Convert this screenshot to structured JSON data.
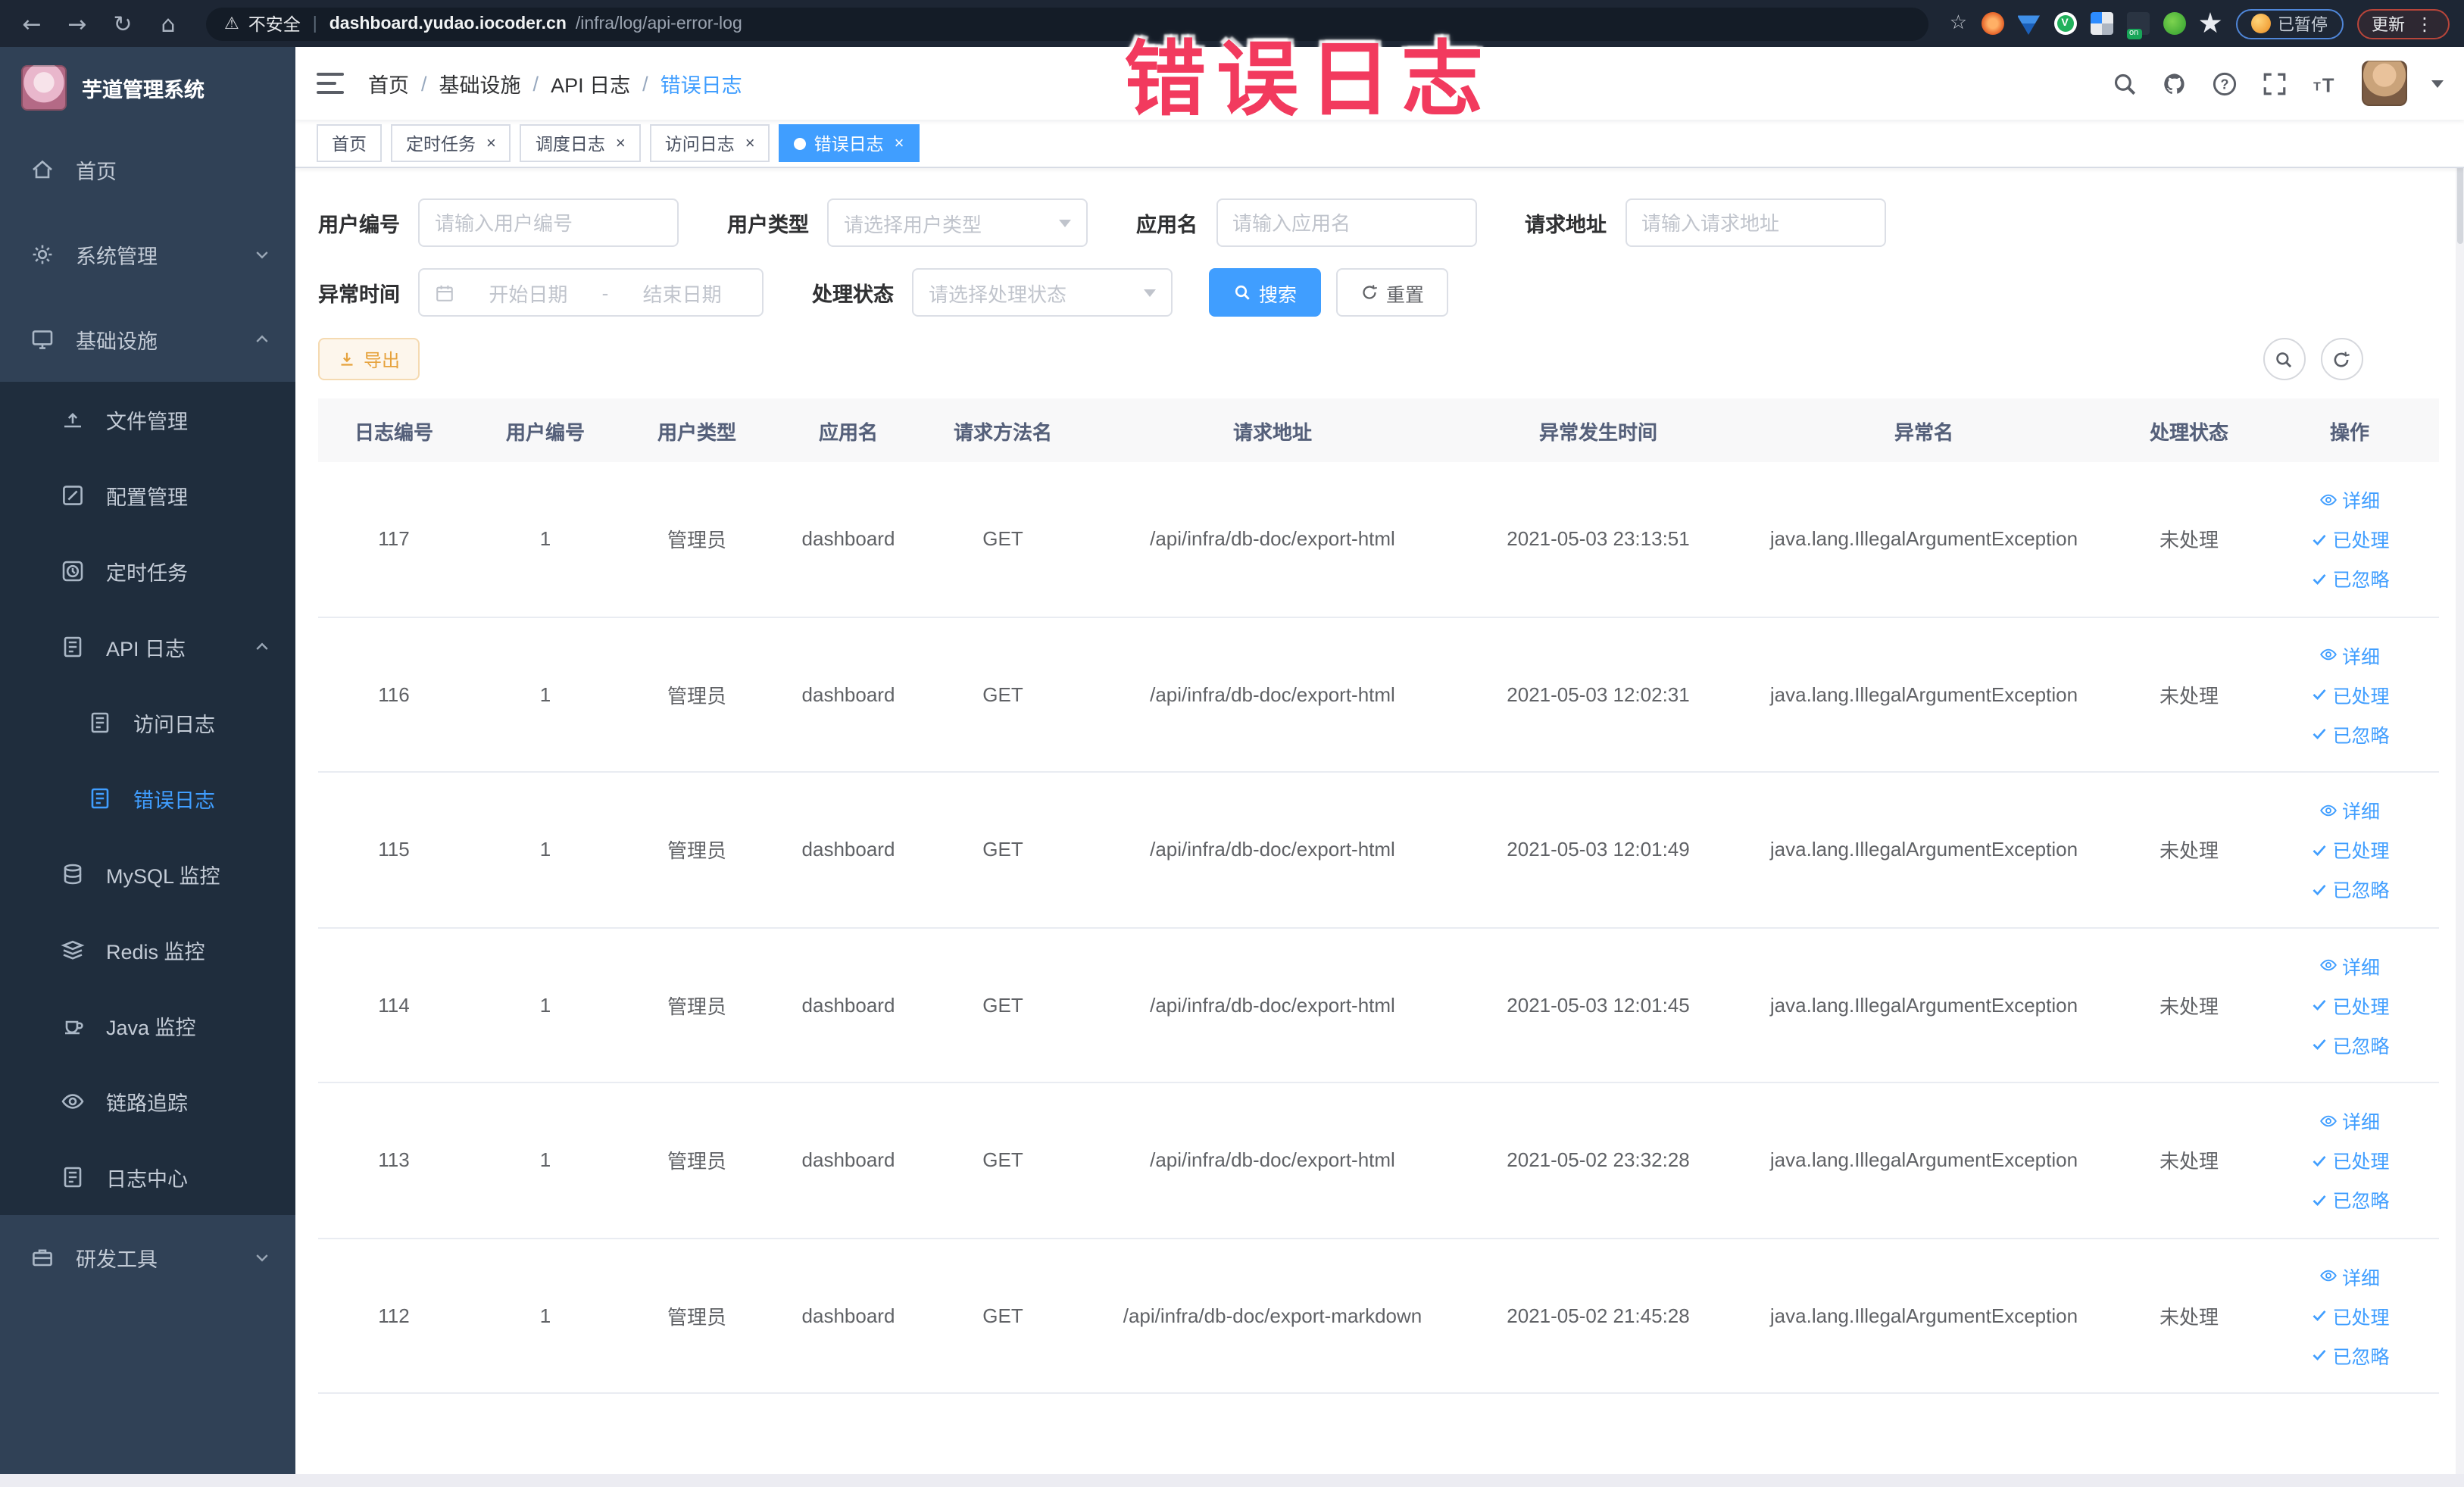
{
  "annotation": {
    "text": "错误日志",
    "color": "#f23a5e"
  },
  "browser": {
    "insecure_label": "不安全",
    "url_domain": "dashboard.yudao.iocoder.cn",
    "url_path": "/infra/log/api-error-log",
    "paused_badge": "已暂停",
    "update_badge": "更新"
  },
  "sidebar": {
    "logo_title": "芋道管理系统",
    "items": [
      {
        "key": "home",
        "label": "首页",
        "icon": "home",
        "level": 0
      },
      {
        "key": "system-management",
        "label": "系统管理",
        "icon": "gear",
        "level": 0,
        "chevron": "down"
      },
      {
        "key": "infrastructure",
        "label": "基础设施",
        "icon": "infra",
        "level": 0,
        "chevron": "up"
      },
      {
        "key": "file-management",
        "label": "文件管理",
        "icon": "upload",
        "level": 1,
        "sub": true
      },
      {
        "key": "config-management",
        "label": "配置管理",
        "icon": "edit",
        "level": 1,
        "sub": true
      },
      {
        "key": "scheduled-task",
        "label": "定时任务",
        "icon": "timer",
        "level": 1,
        "sub": true
      },
      {
        "key": "api-log",
        "label": "API 日志",
        "icon": "log",
        "level": 1,
        "sub": true,
        "chevron": "up"
      },
      {
        "key": "access-log",
        "label": "访问日志",
        "icon": "log",
        "level": 2,
        "sub": true
      },
      {
        "key": "error-log",
        "label": "错误日志",
        "icon": "log",
        "level": 2,
        "sub": true,
        "active": true
      },
      {
        "key": "mysql-monitor",
        "label": "MySQL 监控",
        "icon": "mysql",
        "level": 1,
        "sub": true
      },
      {
        "key": "redis-monitor",
        "label": "Redis 监控",
        "icon": "redis",
        "level": 1,
        "sub": true
      },
      {
        "key": "java-monitor",
        "label": "Java 监控",
        "icon": "java",
        "level": 1,
        "sub": true
      },
      {
        "key": "trace",
        "label": "链路追踪",
        "icon": "eye",
        "level": 1,
        "sub": true
      },
      {
        "key": "log-center",
        "label": "日志中心",
        "icon": "log",
        "level": 1,
        "sub": true
      },
      {
        "key": "dev-tools",
        "label": "研发工具",
        "icon": "tools",
        "level": 0,
        "chevron": "down"
      }
    ]
  },
  "breadcrumb": {
    "separator": "/",
    "items": [
      "首页",
      "基础设施",
      "API 日志",
      "错误日志"
    ]
  },
  "tabs": [
    {
      "key": "home",
      "label": "首页",
      "closable": false,
      "active": false
    },
    {
      "key": "scheduled-task",
      "label": "定时任务",
      "closable": true,
      "active": false
    },
    {
      "key": "schedule-log",
      "label": "调度日志",
      "closable": true,
      "active": false
    },
    {
      "key": "access-log",
      "label": "访问日志",
      "closable": true,
      "active": false
    },
    {
      "key": "error-log",
      "label": "错误日志",
      "closable": true,
      "active": true
    }
  ],
  "filters": {
    "user_id": {
      "label": "用户编号",
      "placeholder": "请输入用户编号"
    },
    "user_type": {
      "label": "用户类型",
      "placeholder": "请选择用户类型"
    },
    "app_name": {
      "label": "应用名",
      "placeholder": "请输入应用名"
    },
    "request_url": {
      "label": "请求地址",
      "placeholder": "请输入请求地址"
    },
    "exception_time": {
      "label": "异常时间",
      "start_placeholder": "开始日期",
      "separator": "-",
      "end_placeholder": "结束日期"
    },
    "process_status": {
      "label": "处理状态",
      "placeholder": "请选择处理状态"
    },
    "search_button": "搜索",
    "reset_button": "重置"
  },
  "toolbar": {
    "export_button": "导出"
  },
  "table": {
    "columns": [
      {
        "key": "log-id",
        "label": "日志编号"
      },
      {
        "key": "user-id",
        "label": "用户编号"
      },
      {
        "key": "user-type",
        "label": "用户类型"
      },
      {
        "key": "app-name",
        "label": "应用名"
      },
      {
        "key": "method-name",
        "label": "请求方法名"
      },
      {
        "key": "request-url",
        "label": "请求地址"
      },
      {
        "key": "exception-time",
        "label": "异常发生时间"
      },
      {
        "key": "exception-name",
        "label": "异常名"
      },
      {
        "key": "process-status",
        "label": "处理状态"
      },
      {
        "key": "actions",
        "label": "操作"
      }
    ],
    "row_actions": [
      {
        "key": "detail",
        "label": "详细",
        "icon": "eye"
      },
      {
        "key": "processed",
        "label": "已处理",
        "icon": "check"
      },
      {
        "key": "ignored",
        "label": "已忽略",
        "icon": "check"
      }
    ],
    "rows": [
      {
        "log_id": "117",
        "user_id": "1",
        "user_type": "管理员",
        "app_name": "dashboard",
        "method": "GET",
        "url": "/api/infra/db-doc/export-html",
        "time": "2021-05-03 23:13:51",
        "exception": "java.lang.IllegalArgumentException",
        "status": "未处理"
      },
      {
        "log_id": "116",
        "user_id": "1",
        "user_type": "管理员",
        "app_name": "dashboard",
        "method": "GET",
        "url": "/api/infra/db-doc/export-html",
        "time": "2021-05-03 12:02:31",
        "exception": "java.lang.IllegalArgumentException",
        "status": "未处理"
      },
      {
        "log_id": "115",
        "user_id": "1",
        "user_type": "管理员",
        "app_name": "dashboard",
        "method": "GET",
        "url": "/api/infra/db-doc/export-html",
        "time": "2021-05-03 12:01:49",
        "exception": "java.lang.IllegalArgumentException",
        "status": "未处理"
      },
      {
        "log_id": "114",
        "user_id": "1",
        "user_type": "管理员",
        "app_name": "dashboard",
        "method": "GET",
        "url": "/api/infra/db-doc/export-html",
        "time": "2021-05-03 12:01:45",
        "exception": "java.lang.IllegalArgumentException",
        "status": "未处理"
      },
      {
        "log_id": "113",
        "user_id": "1",
        "user_type": "管理员",
        "app_name": "dashboard",
        "method": "GET",
        "url": "/api/infra/db-doc/export-html",
        "time": "2021-05-02 23:32:28",
        "exception": "java.lang.IllegalArgumentException",
        "status": "未处理"
      },
      {
        "log_id": "112",
        "user_id": "1",
        "user_type": "管理员",
        "app_name": "dashboard",
        "method": "GET",
        "url": "/api/infra/db-doc/export-markdown",
        "time": "2021-05-02 21:45:28",
        "exception": "java.lang.IllegalArgumentException",
        "status": "未处理"
      }
    ]
  }
}
